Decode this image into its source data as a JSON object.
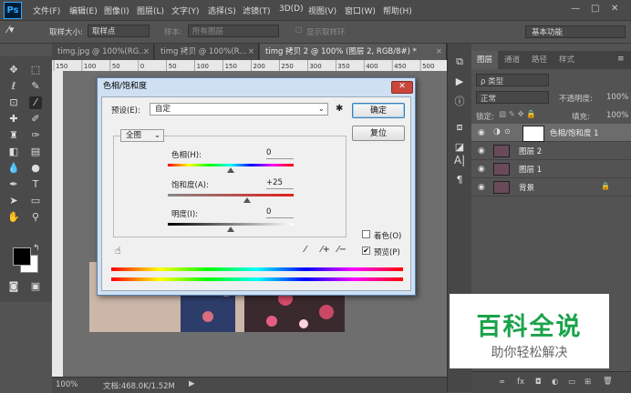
{
  "app": {
    "logo": "Ps"
  },
  "menubar": {
    "items": [
      "文件(F)",
      "编辑(E)",
      "图像(I)",
      "图层(L)",
      "文字(Y)",
      "选择(S)",
      "滤镜(T)",
      "3D(D)",
      "视图(V)",
      "窗口(W)",
      "帮助(H)"
    ],
    "minimize": "—",
    "restore": "□",
    "close": "✕"
  },
  "options": {
    "sample_size_label": "取样大小:",
    "sample_size_value": "取样点",
    "sample_label": "样本:",
    "sample_value": "所有图层",
    "show_ring": "显示取样环",
    "workspace": "基本功能"
  },
  "tabs": [
    {
      "label": "timg.jpg @ 100%(RG..."
    },
    {
      "label": "timg 拷贝 @ 100%(R..."
    },
    {
      "label": "timg 拷贝 2 @ 100% (图层 2, RGB/8#) *"
    }
  ],
  "ruler": {
    "ticks": [
      "150",
      "100",
      "50",
      "0",
      "50",
      "100",
      "150",
      "200",
      "250",
      "300",
      "350",
      "400",
      "450",
      "500"
    ]
  },
  "status": {
    "zoom": "100%",
    "doc": "文档:468.0K/1.52M"
  },
  "layers_panel": {
    "tabs": [
      "图层",
      "通道",
      "路径",
      "样式"
    ],
    "filter": "ρ 类型",
    "blend_mode": "正常",
    "opacity_label": "不透明度:",
    "opacity_value": "100%",
    "lock_label": "锁定:",
    "fill_label": "填充:",
    "fill_value": "100%",
    "layers": [
      {
        "name": "色相/饱和度 1"
      },
      {
        "name": "图层 2"
      },
      {
        "name": "图层 1"
      },
      {
        "name": "背景"
      }
    ],
    "bottom_icons": [
      "∞",
      "fx",
      "◘",
      "◐",
      "▭",
      "⊞",
      "🗑"
    ]
  },
  "dialog": {
    "title": "色相/饱和度",
    "close": "✕",
    "preset_label": "预设(E):",
    "preset_value": "自定",
    "ok": "确定",
    "reset": "复位",
    "channel": "全图",
    "hue_label": "色相(H):",
    "hue_value": "0",
    "sat_label": "饱和度(A):",
    "sat_value": "+25",
    "light_label": "明度(I):",
    "light_value": "0",
    "colorize": "着色(O)",
    "preview": "预览(P)",
    "preview_checked": true,
    "colorize_checked": false
  },
  "watermark": {
    "title": "百科全说",
    "subtitle": "助你轻松解决"
  }
}
